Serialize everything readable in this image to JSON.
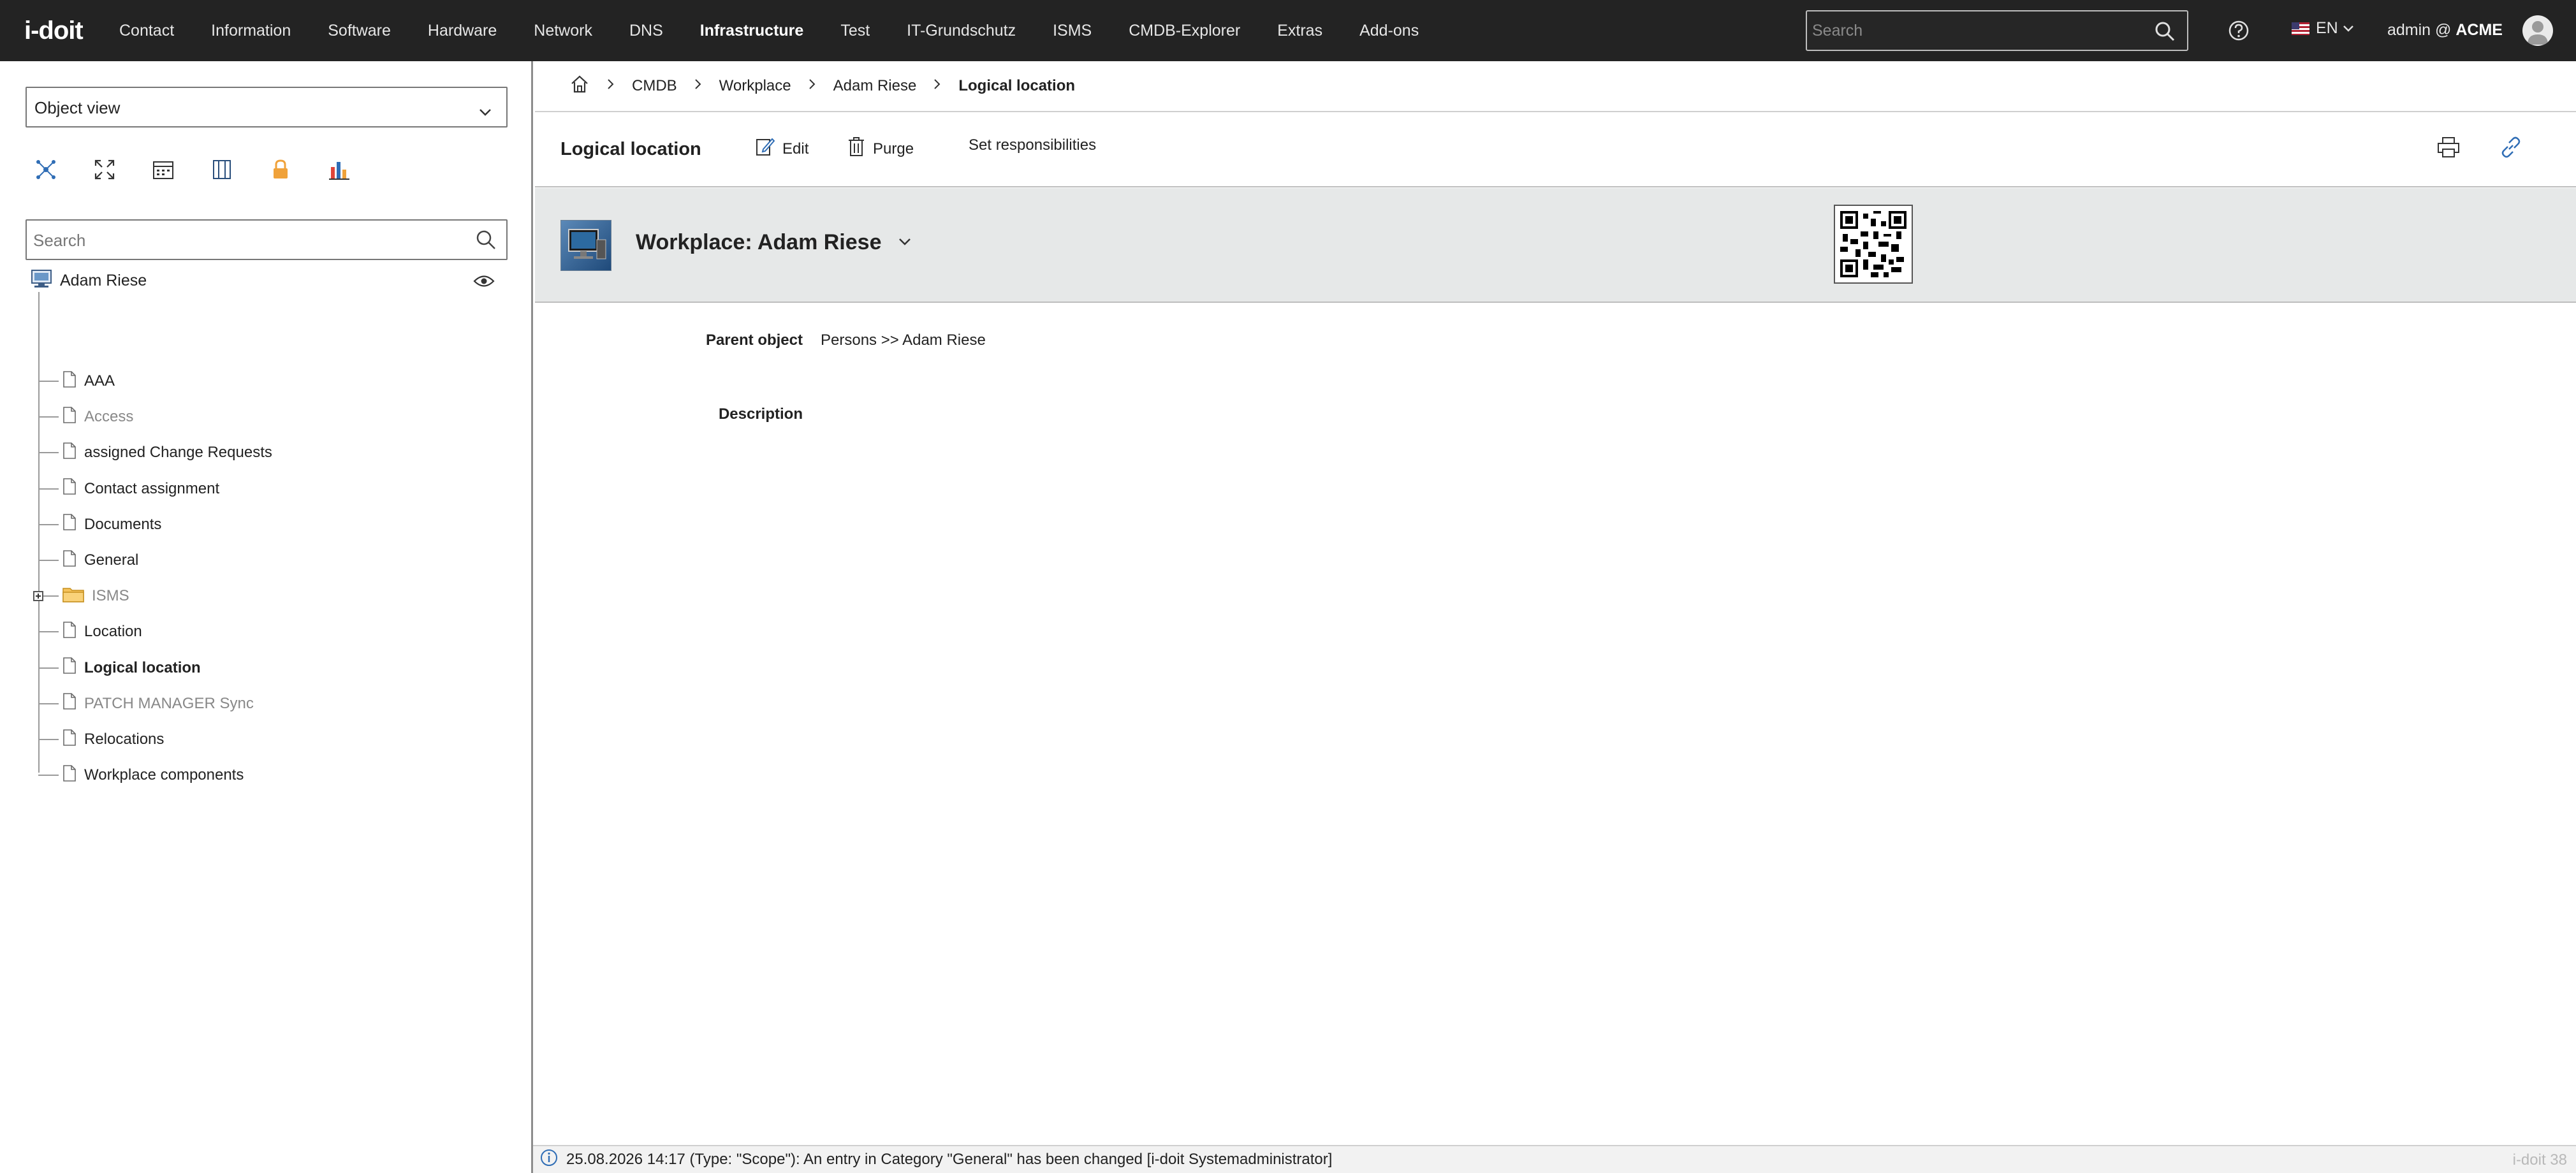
{
  "app": {
    "logo": "i-doit"
  },
  "nav": {
    "items": [
      {
        "label": "Contact",
        "active": false
      },
      {
        "label": "Information",
        "active": false
      },
      {
        "label": "Software",
        "active": false
      },
      {
        "label": "Hardware",
        "active": false
      },
      {
        "label": "Network",
        "active": false
      },
      {
        "label": "DNS",
        "active": false
      },
      {
        "label": "Infrastructure",
        "active": true
      },
      {
        "label": "Test",
        "active": false
      },
      {
        "label": "IT-Grundschutz",
        "active": false
      },
      {
        "label": "ISMS",
        "active": false
      },
      {
        "label": "CMDB-Explorer",
        "active": false
      },
      {
        "label": "Extras",
        "active": false
      },
      {
        "label": "Add-ons",
        "active": false
      }
    ],
    "search_placeholder": "Search",
    "language": "EN",
    "user_prefix": "admin @",
    "user_tenant": "ACME"
  },
  "sidebar": {
    "view_select": "Object view",
    "search_placeholder": "Search",
    "tree_root": "Adam Riese",
    "tree_items": [
      {
        "label": "AAA",
        "state": "normal"
      },
      {
        "label": "Access",
        "state": "dim"
      },
      {
        "label": "assigned Change Requests",
        "state": "normal"
      },
      {
        "label": "Contact assignment",
        "state": "normal"
      },
      {
        "label": "Documents",
        "state": "normal"
      },
      {
        "label": "General",
        "state": "normal"
      },
      {
        "label": "ISMS",
        "state": "dim-folder"
      },
      {
        "label": "Location",
        "state": "normal"
      },
      {
        "label": "Logical location",
        "state": "bold"
      },
      {
        "label": "PATCH MANAGER Sync",
        "state": "dim"
      },
      {
        "label": "Relocations",
        "state": "normal"
      },
      {
        "label": "Workplace components",
        "state": "normal"
      }
    ]
  },
  "breadcrumb": {
    "items": [
      "CMDB",
      "Workplace",
      "Adam Riese"
    ],
    "current": "Logical location"
  },
  "toolbar": {
    "title": "Logical location",
    "edit_label": "Edit",
    "purge_label": "Purge",
    "responsibilities_label": "Set responsibilities"
  },
  "object": {
    "title": "Workplace: Adam Riese"
  },
  "fields": {
    "parent_label": "Parent object",
    "parent_value": "Persons >> Adam Riese",
    "description_label": "Description"
  },
  "status": {
    "message": "25.08.2026 14:17 (Type: \"Scope\"): An entry in Category \"General\" has been changed [i-doit Systemadministrator]",
    "version": "i-doit 38"
  },
  "colors": {
    "topbar_bg": "#232323",
    "accent_blue": "#2f6db5",
    "header_bg": "#e6e8e8",
    "icon_orange": "#f0a23a"
  }
}
